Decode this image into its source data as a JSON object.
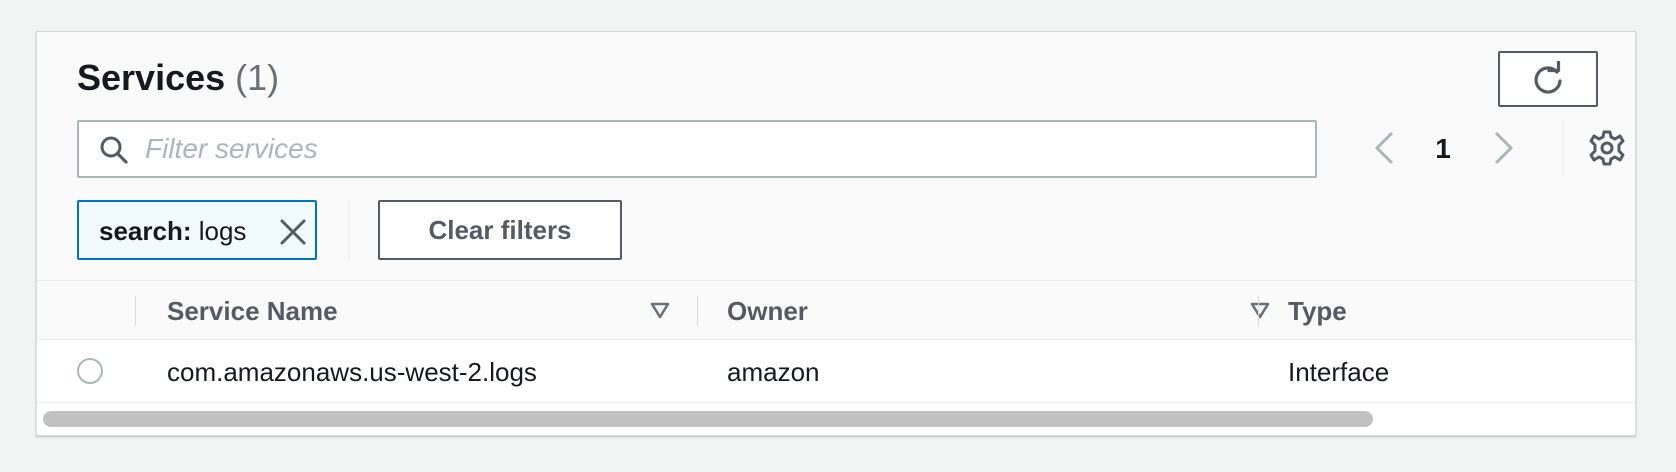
{
  "header": {
    "title": "Services",
    "count": "(1)"
  },
  "search": {
    "placeholder": "Filter services",
    "value": ""
  },
  "pagination": {
    "current_page": "1"
  },
  "filter_token": {
    "key": "search:",
    "value": "logs"
  },
  "clear_filters_label": "Clear filters",
  "table": {
    "columns": [
      {
        "label": "Service Name",
        "sortable": true
      },
      {
        "label": "Owner",
        "sortable": true
      },
      {
        "label": "Type",
        "sortable": false
      }
    ],
    "rows": [
      {
        "service_name": "com.amazonaws.us-west-2.logs",
        "owner": "amazon",
        "type": "Interface",
        "selected": false
      }
    ]
  },
  "icons": {
    "refresh": "refresh-icon",
    "search": "search-icon",
    "prev": "chevron-left-icon",
    "next": "chevron-right-icon",
    "settings": "gear-icon",
    "remove_token": "close-icon",
    "sort": "caret-down-icon"
  },
  "colors": {
    "token_border": "#0073bb",
    "token_bg": "#f1faff",
    "button_border": "#545b64",
    "muted_text": "#687078"
  }
}
